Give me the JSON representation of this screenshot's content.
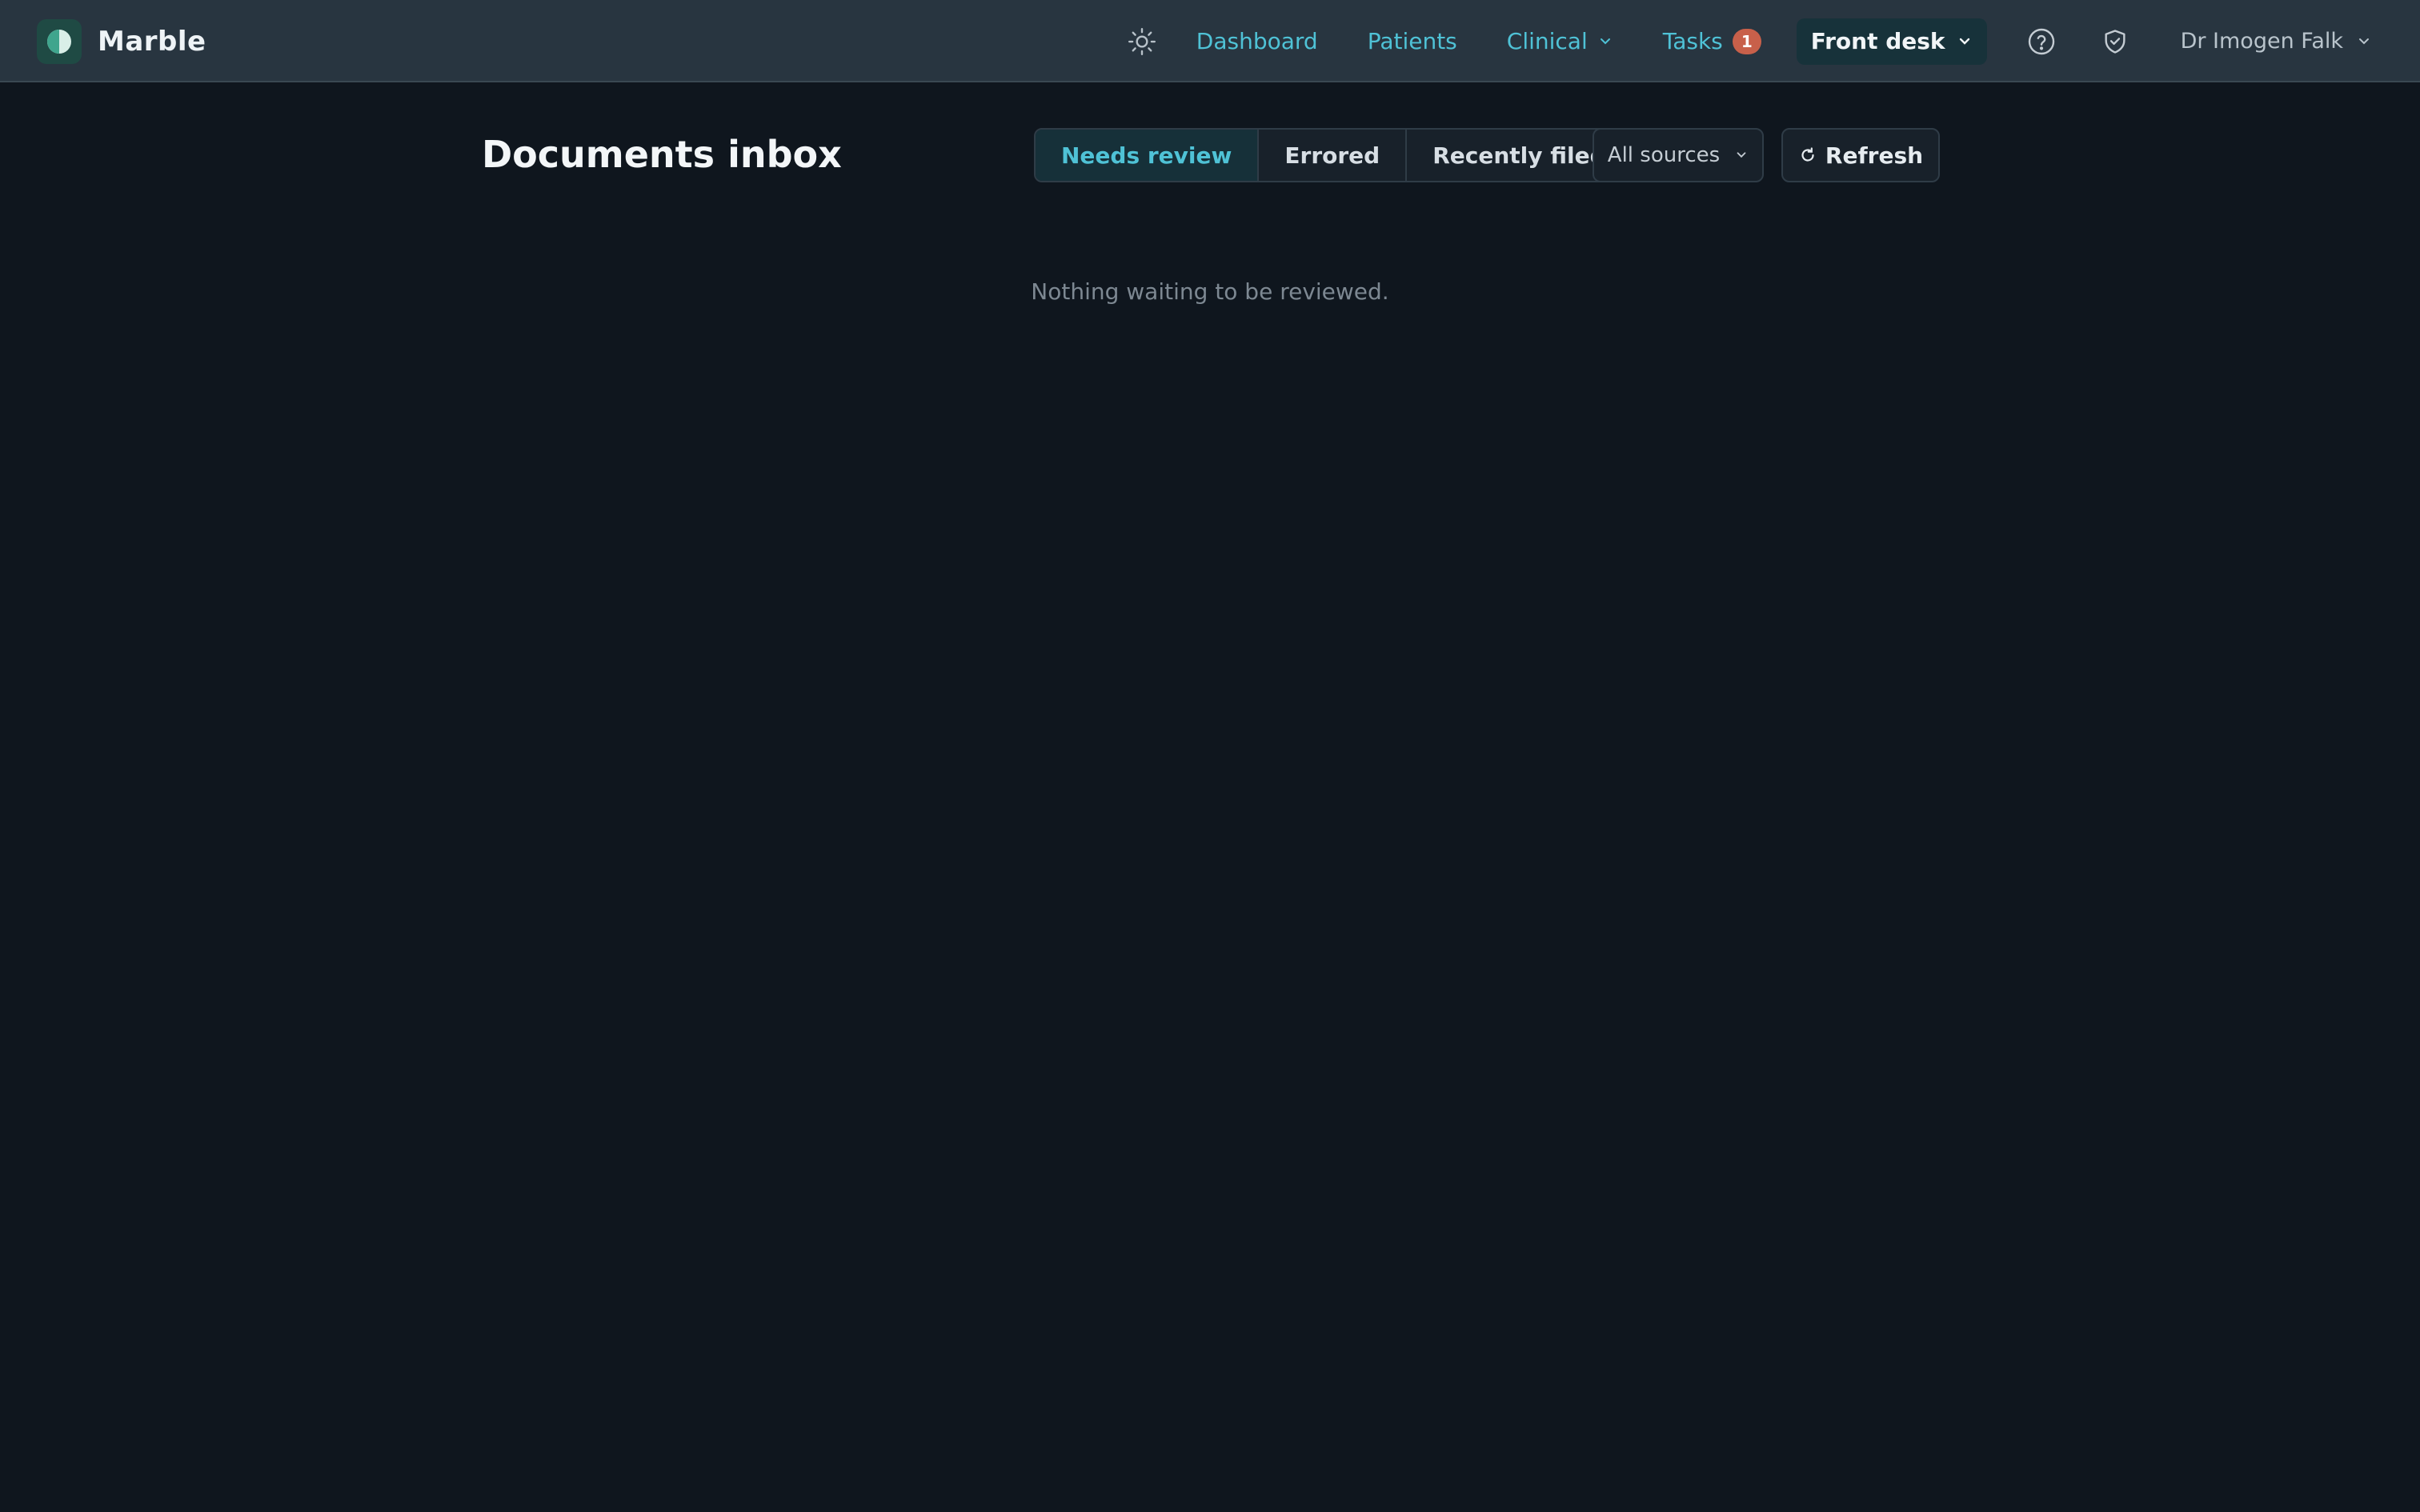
{
  "app": {
    "name": "Marble"
  },
  "nav": {
    "theme_icon": "sun-icon",
    "links": {
      "dashboard": "Dashboard",
      "patients": "Patients",
      "clinical": "Clinical",
      "tasks": "Tasks"
    },
    "tasks_count": "1",
    "role": "Front desk",
    "help_icon": "help-circle-icon",
    "security_icon": "shield-check-icon",
    "user": "Dr Imogen Falk"
  },
  "page": {
    "title": "Documents inbox",
    "filters": {
      "needs_review": "Needs review",
      "errored": "Errored",
      "recently_filed": "Recently filed"
    },
    "active_filter": "needs_review",
    "source_select": "All sources",
    "refresh_label": "Refresh",
    "empty_message": "Nothing waiting to be reviewed."
  },
  "colors": {
    "accent": "#4fc2d6",
    "background": "#0f161e",
    "topbar": "#283540",
    "badge": "#c8604a"
  }
}
